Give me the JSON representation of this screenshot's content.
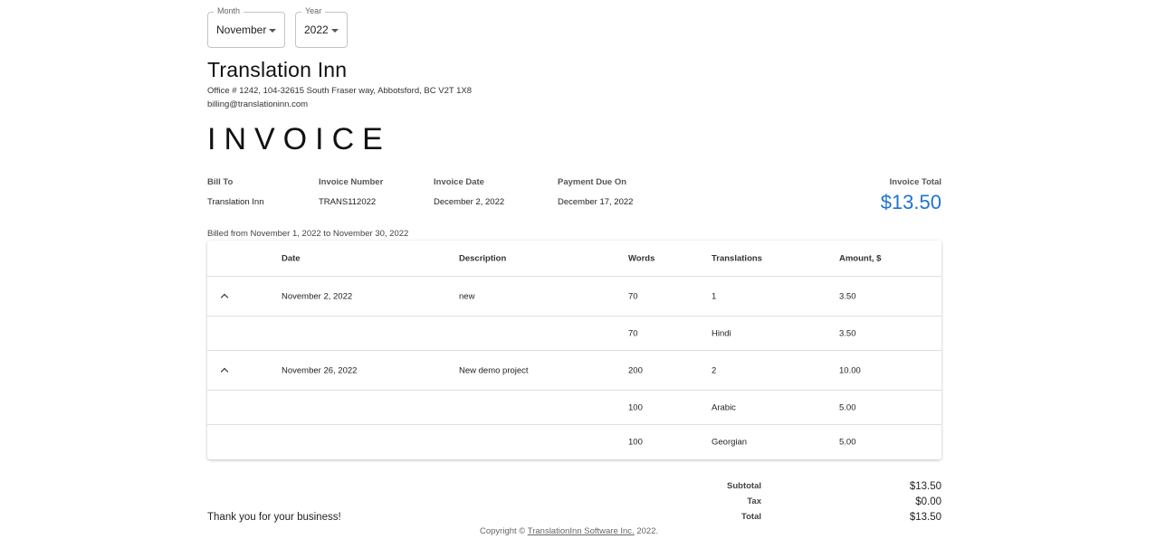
{
  "filters": {
    "month": {
      "label": "Month",
      "value": "November"
    },
    "year": {
      "label": "Year",
      "value": "2022"
    }
  },
  "company": {
    "name": "Translation Inn",
    "address": "Office # 1242, 104-32615 South Fraser way, Abbotsford, BC V2T 1X8",
    "email": "billing@translationinn.com"
  },
  "invoice": {
    "title": "INVOICE",
    "bill_to_label": "Bill To",
    "bill_to": "Translation Inn",
    "number_label": "Invoice Number",
    "number": "TRANS112022",
    "date_label": "Invoice Date",
    "date": "December 2, 2022",
    "due_label": "Payment Due On",
    "due": "December 17, 2022",
    "total_label": "Invoice Total",
    "total": "$13.50",
    "billed_period": "Billed from November 1, 2022 to November 30, 2022"
  },
  "table": {
    "headers": {
      "date": "Date",
      "description": "Description",
      "words": "Words",
      "translations": "Translations",
      "amount": "Amount, $"
    },
    "rows": [
      {
        "date": "November 2, 2022",
        "description": "new",
        "words": "70",
        "translations": "1",
        "amount": "3.50"
      },
      {
        "words": "70",
        "translations": "Hindi",
        "amount": "3.50"
      },
      {
        "date": "November 26, 2022",
        "description": "New demo project",
        "words": "200",
        "translations": "2",
        "amount": "10.00"
      },
      {
        "words": "100",
        "translations": "Arabic",
        "amount": "5.00"
      },
      {
        "words": "100",
        "translations": "Georgian",
        "amount": "5.00"
      }
    ]
  },
  "totals": {
    "subtotal_label": "Subtotal",
    "subtotal": "$13.50",
    "tax_label": "Tax",
    "tax": "$0.00",
    "total_label": "Total",
    "total": "$13.50"
  },
  "footer": {
    "thanks": "Thank you for your business!",
    "copyright_prefix": "Copyright © ",
    "copyright_link": "TranslationInn Software Inc.",
    "copyright_suffix": " 2022."
  },
  "colors": {
    "accent": "#1e73d3"
  },
  "icons": {
    "dropdown": "caret-down-icon",
    "collapse": "chevron-up-icon"
  }
}
